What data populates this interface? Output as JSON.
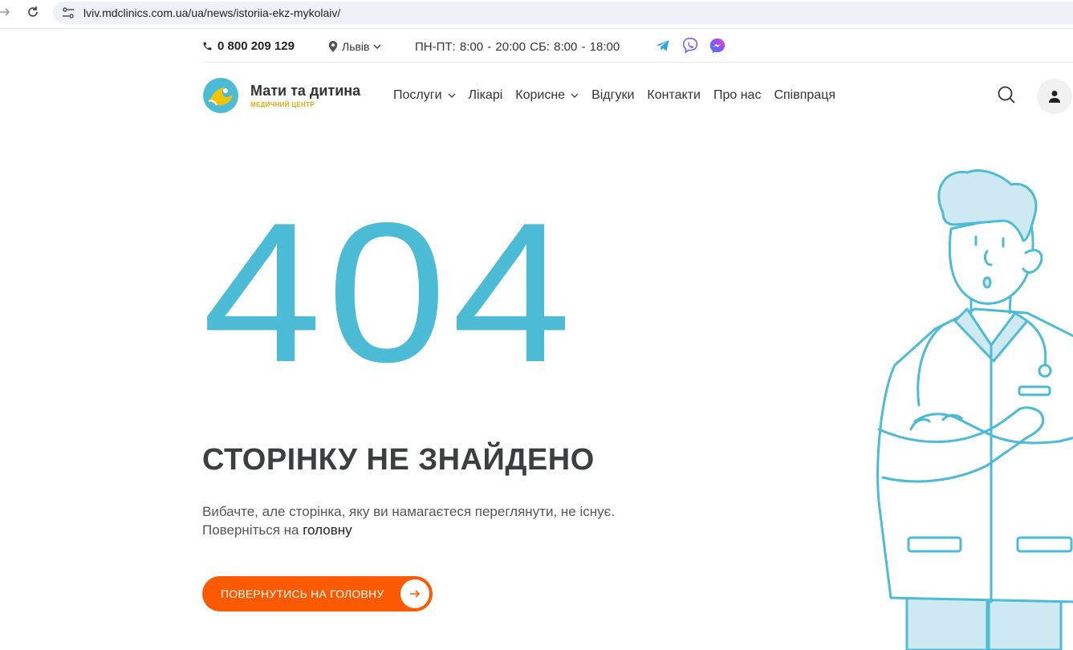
{
  "browser": {
    "url": "lviv.mdclinics.com.ua/ua/news/istoriia-ekz-mykolaiv/"
  },
  "topbar": {
    "phone": "0 800 209 129",
    "city": "Львів",
    "hours": "ПН-ПТ: 8:00 - 20:00  СБ: 8:00 - 18:00",
    "socials": [
      "telegram-icon",
      "viber-icon",
      "messenger-icon"
    ]
  },
  "header": {
    "brand_name": "Мати та дитина",
    "brand_sub": "МЕДИЧНИЙ ЦЕНТР",
    "nav": [
      {
        "label": "Послуги",
        "dropdown": true
      },
      {
        "label": "Лікарі",
        "dropdown": false
      },
      {
        "label": "Корисне",
        "dropdown": true
      },
      {
        "label": "Відгуки",
        "dropdown": false
      },
      {
        "label": "Контакти",
        "dropdown": false
      },
      {
        "label": "Про нас",
        "dropdown": false
      },
      {
        "label": "Співпраця",
        "dropdown": false
      }
    ]
  },
  "main": {
    "code": "404",
    "title": "СТОРІНКУ НЕ ЗНАЙДЕНО",
    "desc_text": "Вибачте, але сторінка, яку ви намагаєтеся переглянути, не існує. Поверніться на ",
    "desc_link": "головну",
    "cta_label": "ПОВЕРНУТИСЬ НА ГОЛОВНУ"
  },
  "colors": {
    "accent": "#4bbbd6",
    "cta": "#fb5a00",
    "brand_yellow": "#e8a800"
  }
}
